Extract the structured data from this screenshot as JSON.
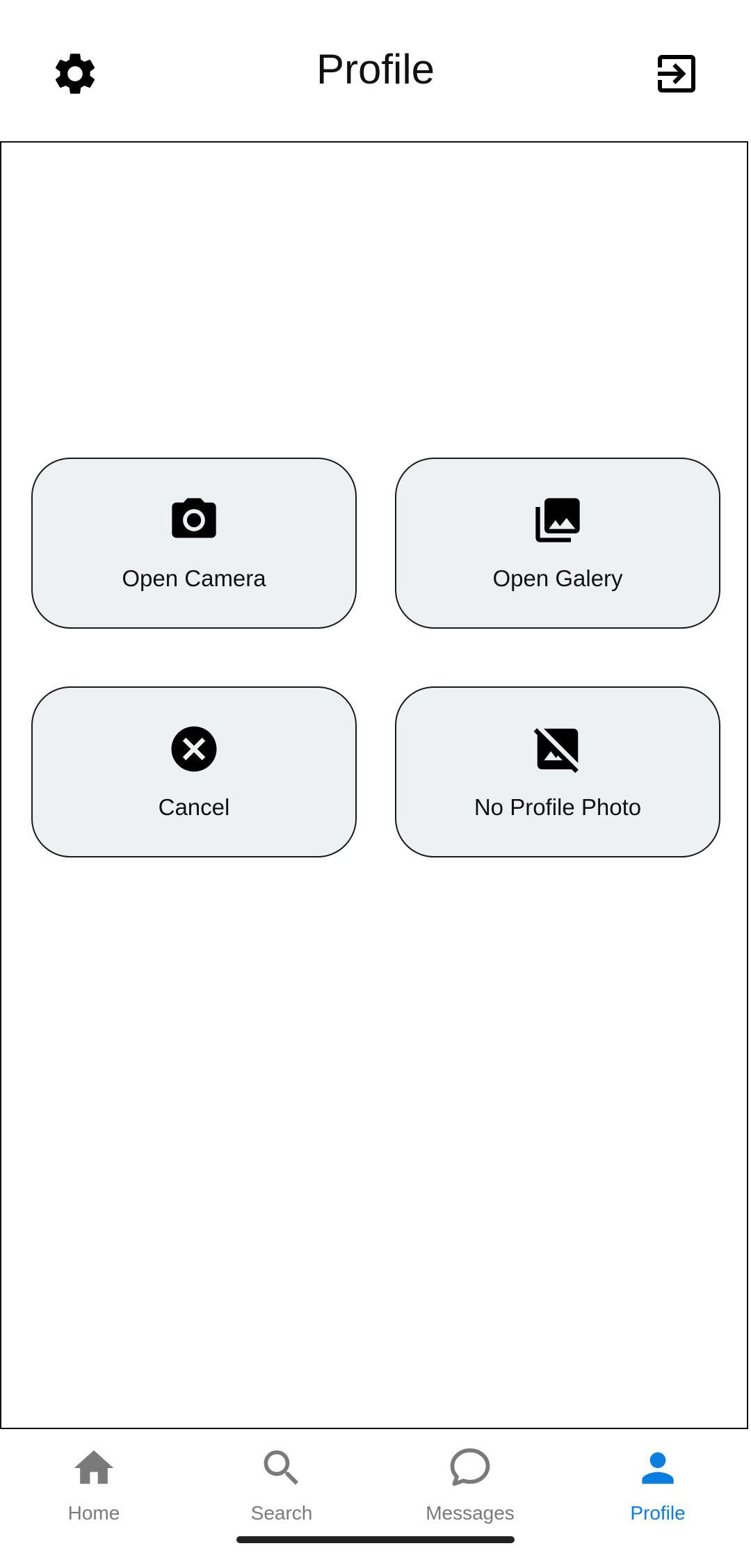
{
  "header": {
    "title": "Profile",
    "left_icon": "gear-icon",
    "right_icon": "logout-icon"
  },
  "actions": [
    {
      "label": "Open Camera",
      "icon": "camera-icon"
    },
    {
      "label": "Open Galery",
      "icon": "gallery-icon"
    },
    {
      "label": "Cancel",
      "icon": "cancel-icon"
    },
    {
      "label": "No Profile Photo",
      "icon": "no-photo-icon"
    }
  ],
  "bottom_nav": {
    "items": [
      {
        "label": "Home",
        "icon": "home-icon",
        "active": false
      },
      {
        "label": "Search",
        "icon": "search-icon",
        "active": false
      },
      {
        "label": "Messages",
        "icon": "chat-bubble-icon",
        "active": false
      },
      {
        "label": "Profile",
        "icon": "person-icon",
        "active": true
      }
    ]
  },
  "colors": {
    "accent": "#0a7de0",
    "inactive": "#7a7a7a",
    "card_bg": "#eef1f2"
  }
}
